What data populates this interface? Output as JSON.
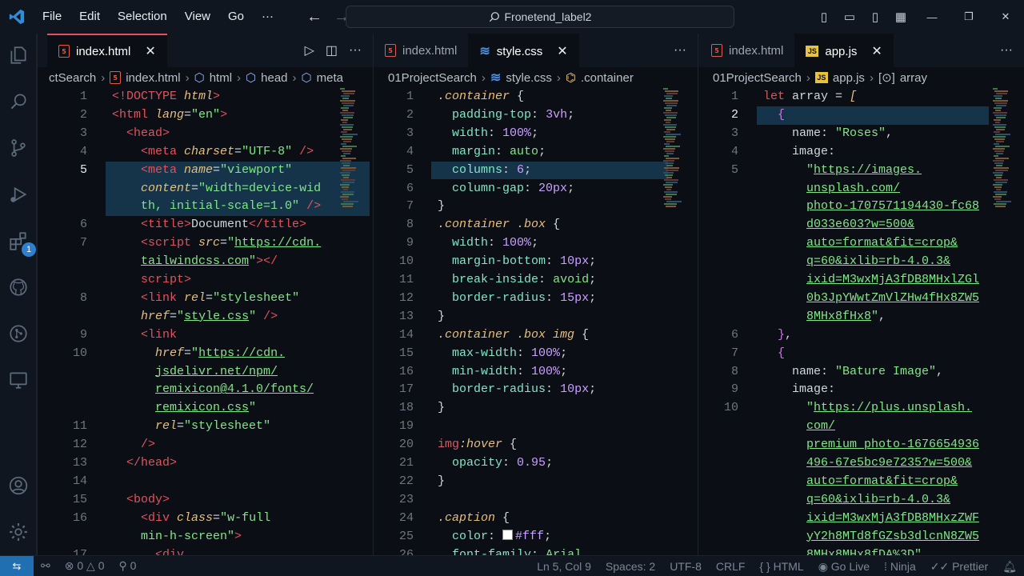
{
  "menu": [
    "File",
    "Edit",
    "Selection",
    "View",
    "Go",
    "···"
  ],
  "search": {
    "label": "Fronetend_label2"
  },
  "activity": {
    "badge": "1"
  },
  "pane1": {
    "tabs": [
      {
        "label": "index.html"
      }
    ],
    "breadcrumb": [
      "ctSearch",
      "index.html",
      "html",
      "head",
      "meta"
    ],
    "lines": [
      {
        "n": "1",
        "cur": false
      },
      {
        "n": "2"
      },
      {
        "n": "3"
      },
      {
        "n": "4"
      },
      {
        "n": "5",
        "cur": true
      },
      {
        "n": ""
      },
      {
        "n": ""
      },
      {
        "n": "6"
      },
      {
        "n": "7"
      },
      {
        "n": ""
      },
      {
        "n": ""
      },
      {
        "n": "8"
      },
      {
        "n": ""
      },
      {
        "n": "9"
      },
      {
        "n": "10"
      },
      {
        "n": ""
      },
      {
        "n": ""
      },
      {
        "n": ""
      },
      {
        "n": "11"
      },
      {
        "n": "12"
      },
      {
        "n": "13"
      },
      {
        "n": "14"
      },
      {
        "n": "15"
      },
      {
        "n": "16"
      },
      {
        "n": ""
      },
      {
        "n": "17"
      }
    ],
    "code": [
      [
        [
          "tag",
          "<!DOCTYPE "
        ],
        [
          "attr",
          "html"
        ],
        [
          "tag",
          ">"
        ]
      ],
      [
        [
          "tag",
          "<html "
        ],
        [
          "attr",
          "lang"
        ],
        [
          "pun",
          "="
        ],
        [
          "str",
          "\"en\""
        ],
        [
          "tag",
          ">"
        ]
      ],
      [
        [
          "pun",
          "  "
        ],
        [
          "tag",
          "<head>"
        ]
      ],
      [
        [
          "pun",
          "    "
        ],
        [
          "tag",
          "<meta "
        ],
        [
          "attr",
          "charset"
        ],
        [
          "pun",
          "="
        ],
        [
          "str",
          "\"UTF-8\""
        ],
        [
          "pun",
          " "
        ],
        [
          "tag",
          "/>"
        ]
      ],
      [
        [
          "pun",
          "    "
        ],
        [
          "tag",
          "<meta "
        ],
        [
          "attr",
          "name"
        ],
        [
          "pun",
          "="
        ],
        [
          "str",
          "\"viewport\""
        ]
      ],
      [
        [
          "pun",
          "    "
        ],
        [
          "attr",
          "content"
        ],
        [
          "pun",
          "="
        ],
        [
          "str",
          "\"width=device-wid"
        ]
      ],
      [
        [
          "pun",
          "    "
        ],
        [
          "str",
          "th, initial-scale=1.0\""
        ],
        [
          "pun",
          " "
        ],
        [
          "tag",
          "/>"
        ]
      ],
      [
        [
          "pun",
          "    "
        ],
        [
          "tag",
          "<title>"
        ],
        [
          "pun",
          "Document"
        ],
        [
          "tag",
          "</title>"
        ]
      ],
      [
        [
          "pun",
          "    "
        ],
        [
          "tag",
          "<script "
        ],
        [
          "attr",
          "src"
        ],
        [
          "pun",
          "="
        ],
        [
          "str",
          "\""
        ],
        [
          "link",
          "https://cdn."
        ]
      ],
      [
        [
          "pun",
          "    "
        ],
        [
          "link",
          "tailwindcss.com"
        ],
        [
          "str",
          "\""
        ],
        [
          "tag",
          "></"
        ]
      ],
      [
        [
          "pun",
          "    "
        ],
        [
          "tag",
          "script>"
        ]
      ],
      [
        [
          "pun",
          "    "
        ],
        [
          "tag",
          "<link "
        ],
        [
          "attr",
          "rel"
        ],
        [
          "pun",
          "="
        ],
        [
          "str",
          "\"stylesheet\""
        ]
      ],
      [
        [
          "pun",
          "    "
        ],
        [
          "attr",
          "href"
        ],
        [
          "pun",
          "="
        ],
        [
          "str",
          "\""
        ],
        [
          "link",
          "style.css"
        ],
        [
          "str",
          "\""
        ],
        [
          "pun",
          " "
        ],
        [
          "tag",
          "/>"
        ]
      ],
      [
        [
          "pun",
          "    "
        ],
        [
          "tag",
          "<link"
        ]
      ],
      [
        [
          "pun",
          "      "
        ],
        [
          "attr",
          "href"
        ],
        [
          "pun",
          "="
        ],
        [
          "str",
          "\""
        ],
        [
          "link",
          "https://cdn."
        ]
      ],
      [
        [
          "pun",
          "      "
        ],
        [
          "link",
          "jsdelivr.net/npm/"
        ]
      ],
      [
        [
          "pun",
          "      "
        ],
        [
          "link",
          "remixicon@4.1.0/fonts/"
        ]
      ],
      [
        [
          "pun",
          "      "
        ],
        [
          "link",
          "remixicon.css"
        ],
        [
          "str",
          "\""
        ]
      ],
      [
        [
          "pun",
          "      "
        ],
        [
          "attr",
          "rel"
        ],
        [
          "pun",
          "="
        ],
        [
          "str",
          "\"stylesheet\""
        ]
      ],
      [
        [
          "pun",
          "    "
        ],
        [
          "tag",
          "/>"
        ]
      ],
      [
        [
          "pun",
          "  "
        ],
        [
          "tag",
          "</head>"
        ]
      ],
      [
        [
          "pun",
          ""
        ]
      ],
      [
        [
          "pun",
          "  "
        ],
        [
          "tag",
          "<body>"
        ]
      ],
      [
        [
          "pun",
          "    "
        ],
        [
          "tag",
          "<div "
        ],
        [
          "attr",
          "class"
        ],
        [
          "pun",
          "="
        ],
        [
          "str",
          "\"w-full"
        ]
      ],
      [
        [
          "pun",
          "    "
        ],
        [
          "str",
          "min-h-screen\""
        ],
        [
          "tag",
          ">"
        ]
      ],
      [
        [
          "pun",
          "      "
        ],
        [
          "tag",
          "<div"
        ]
      ]
    ]
  },
  "pane2": {
    "tabs": [
      {
        "label": "index.html"
      },
      {
        "label": "style.css"
      }
    ],
    "breadcrumb": [
      "01ProjectSearch",
      "style.css",
      ".container"
    ],
    "lines": [
      "1",
      "2",
      "3",
      "4",
      "5",
      "6",
      "7",
      "8",
      "9",
      "10",
      "11",
      "12",
      "13",
      "14",
      "15",
      "16",
      "17",
      "18",
      "19",
      "20",
      "21",
      "22",
      "23",
      "24",
      "25",
      "26"
    ],
    "code": [
      [
        [
          "sel",
          ".container"
        ],
        [
          "pun",
          " {"
        ]
      ],
      [
        [
          "pun",
          "  "
        ],
        [
          "prop",
          "padding-top"
        ],
        [
          "pun",
          ": "
        ],
        [
          "num",
          "3vh"
        ],
        [
          "pun",
          ";"
        ]
      ],
      [
        [
          "pun",
          "  "
        ],
        [
          "prop",
          "width"
        ],
        [
          "pun",
          ": "
        ],
        [
          "num",
          "100%"
        ],
        [
          "pun",
          ";"
        ]
      ],
      [
        [
          "pun",
          "  "
        ],
        [
          "prop",
          "margin"
        ],
        [
          "pun",
          ": "
        ],
        [
          "str",
          "auto"
        ],
        [
          "pun",
          ";"
        ]
      ],
      [
        [
          "pun",
          "  "
        ],
        [
          "prop",
          "columns"
        ],
        [
          "pun",
          ": "
        ],
        [
          "num",
          "6"
        ],
        [
          "pun",
          ";"
        ]
      ],
      [
        [
          "pun",
          "  "
        ],
        [
          "prop",
          "column-gap"
        ],
        [
          "pun",
          ": "
        ],
        [
          "num",
          "20px"
        ],
        [
          "pun",
          ";"
        ]
      ],
      [
        [
          "pun",
          "}"
        ]
      ],
      [
        [
          "sel",
          ".container .box"
        ],
        [
          "pun",
          " {"
        ]
      ],
      [
        [
          "pun",
          "  "
        ],
        [
          "prop",
          "width"
        ],
        [
          "pun",
          ": "
        ],
        [
          "num",
          "100%"
        ],
        [
          "pun",
          ";"
        ]
      ],
      [
        [
          "pun",
          "  "
        ],
        [
          "prop",
          "margin-bottom"
        ],
        [
          "pun",
          ": "
        ],
        [
          "num",
          "10px"
        ],
        [
          "pun",
          ";"
        ]
      ],
      [
        [
          "pun",
          "  "
        ],
        [
          "prop",
          "break-inside"
        ],
        [
          "pun",
          ": "
        ],
        [
          "str",
          "avoid"
        ],
        [
          "pun",
          ";"
        ]
      ],
      [
        [
          "pun",
          "  "
        ],
        [
          "prop",
          "border-radius"
        ],
        [
          "pun",
          ": "
        ],
        [
          "num",
          "15px"
        ],
        [
          "pun",
          ";"
        ]
      ],
      [
        [
          "pun",
          "}"
        ]
      ],
      [
        [
          "sel",
          ".container .box img"
        ],
        [
          "pun",
          " {"
        ]
      ],
      [
        [
          "pun",
          "  "
        ],
        [
          "prop",
          "max-width"
        ],
        [
          "pun",
          ": "
        ],
        [
          "num",
          "100%"
        ],
        [
          "pun",
          ";"
        ]
      ],
      [
        [
          "pun",
          "  "
        ],
        [
          "prop",
          "min-width"
        ],
        [
          "pun",
          ": "
        ],
        [
          "num",
          "100%"
        ],
        [
          "pun",
          ";"
        ]
      ],
      [
        [
          "pun",
          "  "
        ],
        [
          "prop",
          "border-radius"
        ],
        [
          "pun",
          ": "
        ],
        [
          "num",
          "10px"
        ],
        [
          "pun",
          ";"
        ]
      ],
      [
        [
          "pun",
          "}"
        ]
      ],
      [
        [
          "pun",
          ""
        ]
      ],
      [
        [
          "kw",
          "img"
        ],
        [
          "sel",
          ":hover"
        ],
        [
          "pun",
          " {"
        ]
      ],
      [
        [
          "pun",
          "  "
        ],
        [
          "prop",
          "opacity"
        ],
        [
          "pun",
          ": "
        ],
        [
          "num",
          "0.95"
        ],
        [
          "pun",
          ";"
        ]
      ],
      [
        [
          "pun",
          "}"
        ]
      ],
      [
        [
          "pun",
          ""
        ]
      ],
      [
        [
          "sel",
          ".caption"
        ],
        [
          "pun",
          " {"
        ]
      ],
      [
        [
          "pun",
          "  "
        ],
        [
          "prop",
          "color"
        ],
        [
          "pun",
          ": "
        ],
        [
          "swatch",
          "#fff"
        ],
        [
          "pun",
          ";"
        ]
      ],
      [
        [
          "pun",
          "  "
        ],
        [
          "prop",
          "font-family"
        ],
        [
          "pun",
          ": "
        ],
        [
          "str",
          "Arial"
        ]
      ]
    ]
  },
  "pane3": {
    "tabs": [
      {
        "label": "index.html"
      },
      {
        "label": "app.js"
      }
    ],
    "breadcrumb": [
      "01ProjectSearch",
      "app.js",
      "array"
    ],
    "lines": [
      {
        "n": "1"
      },
      {
        "n": "2",
        "cur": true
      },
      {
        "n": "3"
      },
      {
        "n": "4"
      },
      {
        "n": "5"
      },
      {
        "n": ""
      },
      {
        "n": ""
      },
      {
        "n": ""
      },
      {
        "n": ""
      },
      {
        "n": ""
      },
      {
        "n": ""
      },
      {
        "n": ""
      },
      {
        "n": ""
      },
      {
        "n": "6"
      },
      {
        "n": "7"
      },
      {
        "n": "8"
      },
      {
        "n": "9"
      },
      {
        "n": "10"
      },
      {
        "n": ""
      },
      {
        "n": ""
      },
      {
        "n": ""
      },
      {
        "n": ""
      },
      {
        "n": ""
      },
      {
        "n": ""
      },
      {
        "n": ""
      },
      {
        "n": ""
      }
    ],
    "code": [
      [
        [
          "kw",
          "let "
        ],
        [
          "pun",
          "array = "
        ],
        [
          "sel",
          "["
        ]
      ],
      [
        [
          "pun",
          "  "
        ],
        [
          "tagp",
          "{"
        ]
      ],
      [
        [
          "pun",
          "    name: "
        ],
        [
          "str",
          "\"Roses\""
        ],
        [
          "pun",
          ","
        ]
      ],
      [
        [
          "pun",
          "    image:"
        ]
      ],
      [
        [
          "pun",
          "      "
        ],
        [
          "str",
          "\""
        ],
        [
          "link",
          "https://images."
        ]
      ],
      [
        [
          "pun",
          "      "
        ],
        [
          "link",
          "unsplash.com/"
        ]
      ],
      [
        [
          "pun",
          "      "
        ],
        [
          "link",
          "photo-1707571194430-fc68"
        ]
      ],
      [
        [
          "pun",
          "      "
        ],
        [
          "link",
          "d033e603?w=500&"
        ]
      ],
      [
        [
          "pun",
          "      "
        ],
        [
          "link",
          "auto=format&fit=crop&"
        ]
      ],
      [
        [
          "pun",
          "      "
        ],
        [
          "link",
          "q=60&ixlib=rb-4.0.3&"
        ]
      ],
      [
        [
          "pun",
          "      "
        ],
        [
          "link",
          "ixid=M3wxMjA3fDB8MHxlZGl"
        ]
      ],
      [
        [
          "pun",
          "      "
        ],
        [
          "link",
          "0b3JpYWwtZmVlZHw4fHx8ZW5"
        ]
      ],
      [
        [
          "pun",
          "      "
        ],
        [
          "link",
          "8MHx8fHx8"
        ],
        [
          "str",
          "\""
        ],
        [
          "pun",
          ","
        ]
      ],
      [
        [
          "pun",
          "  "
        ],
        [
          "tagp",
          "}"
        ],
        [
          "pun",
          ","
        ]
      ],
      [
        [
          "pun",
          "  "
        ],
        [
          "tagp",
          "{"
        ]
      ],
      [
        [
          "pun",
          "    name: "
        ],
        [
          "str",
          "\"Bature Image\""
        ],
        [
          "pun",
          ","
        ]
      ],
      [
        [
          "pun",
          "    image:"
        ]
      ],
      [
        [
          "pun",
          "      "
        ],
        [
          "str",
          "\""
        ],
        [
          "link",
          "https://plus.unsplash."
        ]
      ],
      [
        [
          "pun",
          "      "
        ],
        [
          "link",
          "com/"
        ]
      ],
      [
        [
          "pun",
          "      "
        ],
        [
          "link",
          "premium_photo-1676654936"
        ]
      ],
      [
        [
          "pun",
          "      "
        ],
        [
          "link",
          "496-67e5bc9e7235?w=500&"
        ]
      ],
      [
        [
          "pun",
          "      "
        ],
        [
          "link",
          "auto=format&fit=crop&"
        ]
      ],
      [
        [
          "pun",
          "      "
        ],
        [
          "link",
          "q=60&ixlib=rb-4.0.3&"
        ]
      ],
      [
        [
          "pun",
          "      "
        ],
        [
          "link",
          "ixid=M3wxMjA3fDB8MHxzZWF"
        ]
      ],
      [
        [
          "pun",
          "      "
        ],
        [
          "link",
          "yY2h8MTd8fGZsb3dlcnN8ZW5"
        ]
      ],
      [
        [
          "pun",
          "      "
        ],
        [
          "link",
          "8MHx8MHx8fDA%3D"
        ],
        [
          "str",
          "\""
        ]
      ]
    ]
  },
  "status": {
    "errors": "0",
    "warnings": "0",
    "ports": "0",
    "position": "Ln 5, Col 9",
    "spaces": "Spaces: 2",
    "encoding": "UTF-8",
    "eol": "CRLF",
    "language": "HTML",
    "golive": "Go Live",
    "ninja": "Ninja",
    "prettier": "Prettier"
  },
  "colors": {
    "accent": "#e0525d",
    "remote": "#1f6fb2",
    "highlight": "#15344a"
  }
}
